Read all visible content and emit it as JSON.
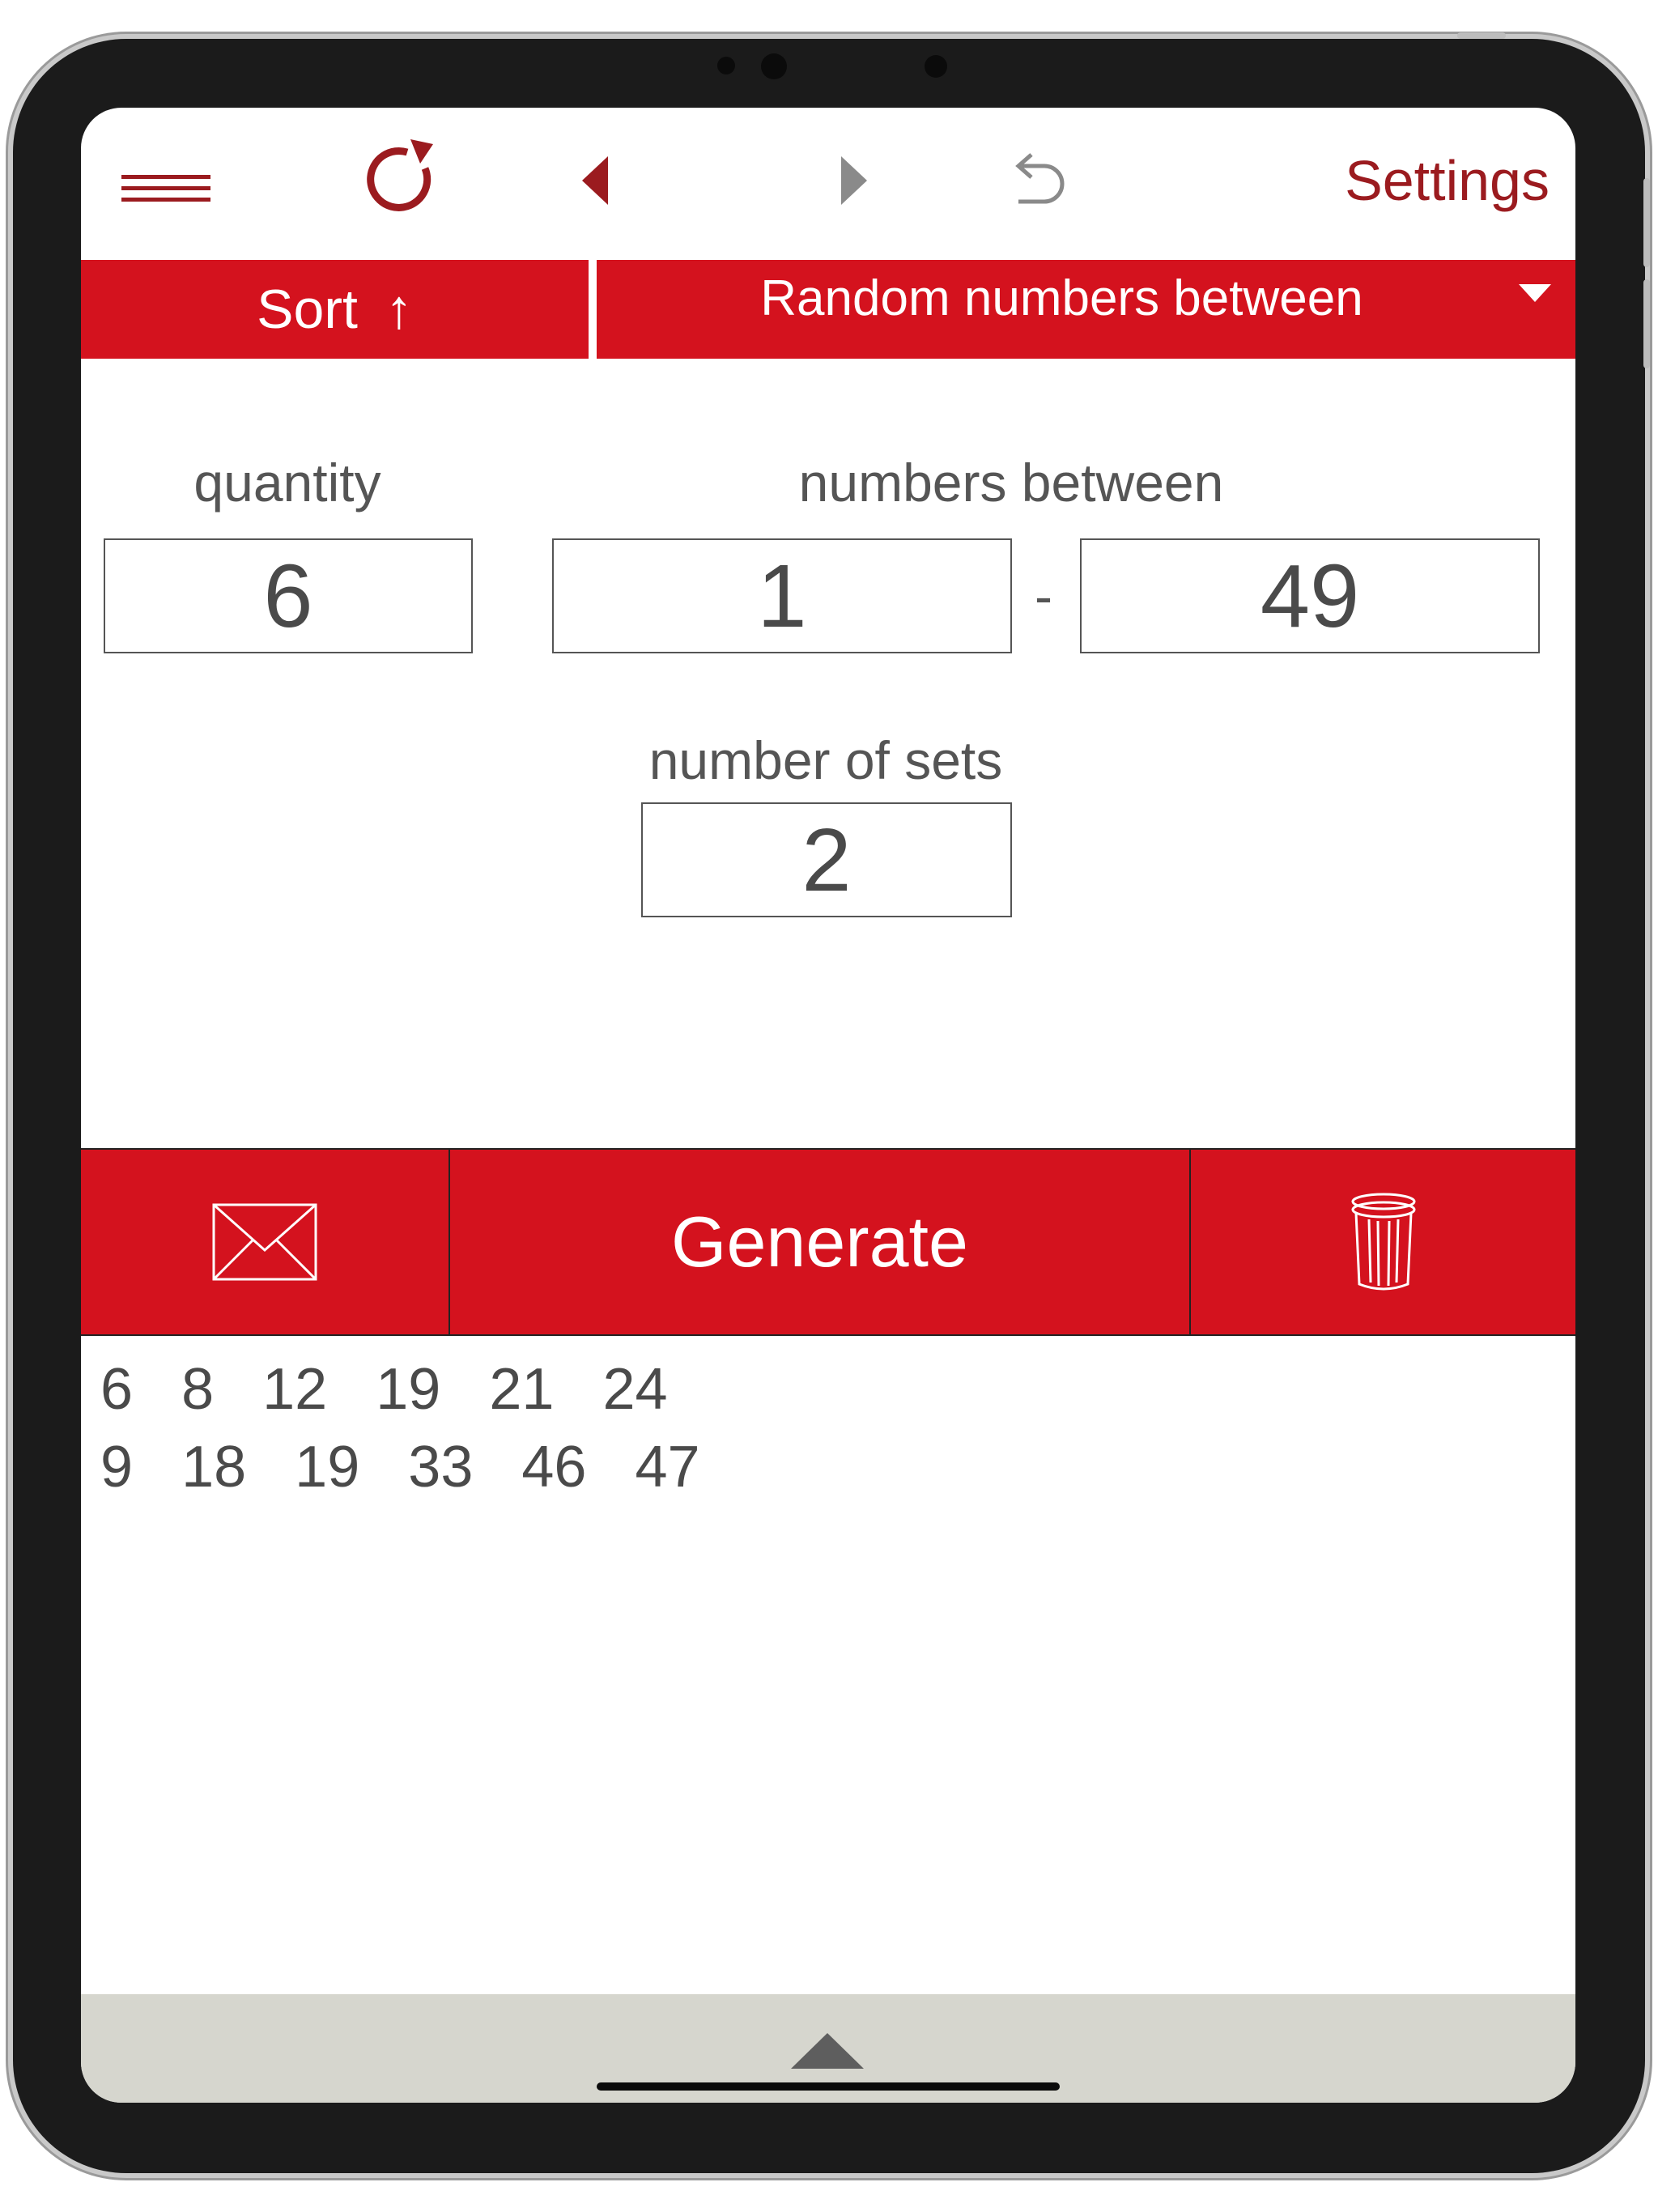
{
  "toolbar": {
    "menu_icon": "hamburger-icon",
    "refresh_icon": "refresh-icon",
    "back_icon": "back-triangle-icon",
    "forward_icon": "forward-triangle-icon",
    "undo_icon": "undo-icon",
    "settings_label": "Settings"
  },
  "controls": {
    "sort_label": "Sort",
    "sort_arrow": "↑",
    "mode_label": "Random numbers between"
  },
  "form": {
    "quantity_label": "quantity",
    "quantity_value": "6",
    "range_label": "numbers between",
    "range_min": "1",
    "range_separator": "-",
    "range_max": "49",
    "sets_label": "number of sets",
    "sets_value": "2"
  },
  "actions": {
    "mail_icon": "envelope-icon",
    "generate_label": "Generate",
    "trash_icon": "trash-icon"
  },
  "results": {
    "sets": [
      [
        "6",
        "8",
        "12",
        "19",
        "21",
        "24"
      ],
      [
        "9",
        "18",
        "19",
        "33",
        "46",
        "47"
      ]
    ]
  },
  "colors": {
    "accent_red": "#d4121e",
    "dark_red": "#9b1b1f",
    "footer_gray": "#d6d6ce"
  }
}
